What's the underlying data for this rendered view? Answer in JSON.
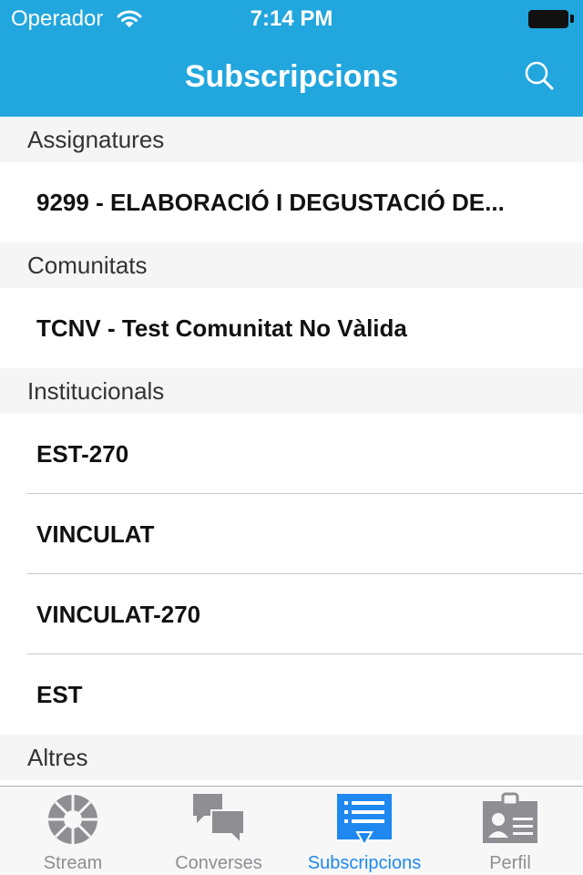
{
  "status_bar": {
    "carrier": "Operador",
    "time": "7:14 PM"
  },
  "nav": {
    "title": "Subscripcions"
  },
  "sections": [
    {
      "title": "Assignatures",
      "items": [
        "9299 - ELABORACIÓ I DEGUSTACIÓ DE..."
      ]
    },
    {
      "title": "Comunitats",
      "items": [
        "TCNV - Test Comunitat No Vàlida"
      ]
    },
    {
      "title": "Institucionals",
      "items": [
        "EST-270",
        "VINCULAT",
        "VINCULAT-270",
        "EST"
      ]
    },
    {
      "title": "Altres",
      "items": []
    }
  ],
  "tabbar": {
    "tabs": [
      {
        "label": "Stream",
        "icon": "stream-icon"
      },
      {
        "label": "Converses",
        "icon": "conversations-icon"
      },
      {
        "label": "Subscripcions",
        "icon": "subscriptions-icon",
        "active": true
      },
      {
        "label": "Perfil",
        "icon": "profile-icon"
      }
    ]
  },
  "colors": {
    "header": "#22a6de",
    "active_tab": "#1e88f0",
    "inactive_tab": "#8e8e93"
  }
}
